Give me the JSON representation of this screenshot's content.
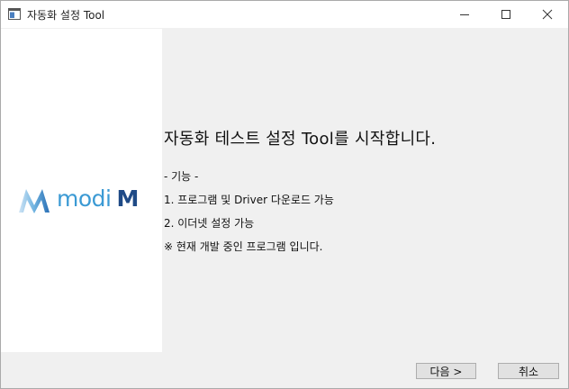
{
  "window": {
    "title": "자동화 설정 Tool"
  },
  "logo": {
    "text": "modi",
    "mark": "M"
  },
  "content": {
    "heading": "자동화 테스트 설정 Tool를 시작합니다.",
    "lines": [
      "- 기능 -",
      "1. 프로그램 및 Driver 다운로드 가능",
      "2. 이더넷 설정 가능",
      "※ 현재 개발 중인 프로그램 입니다."
    ]
  },
  "buttons": {
    "next_label": "다음 >",
    "cancel_label": "취소"
  },
  "colors": {
    "logo_light": "#3b9ad4",
    "logo_dark": "#1f4a86",
    "button_face": "#e1e1e1"
  },
  "icons": {
    "app": "app-window-icon",
    "minimize": "minimize-icon",
    "maximize": "maximize-icon",
    "close": "close-icon"
  }
}
